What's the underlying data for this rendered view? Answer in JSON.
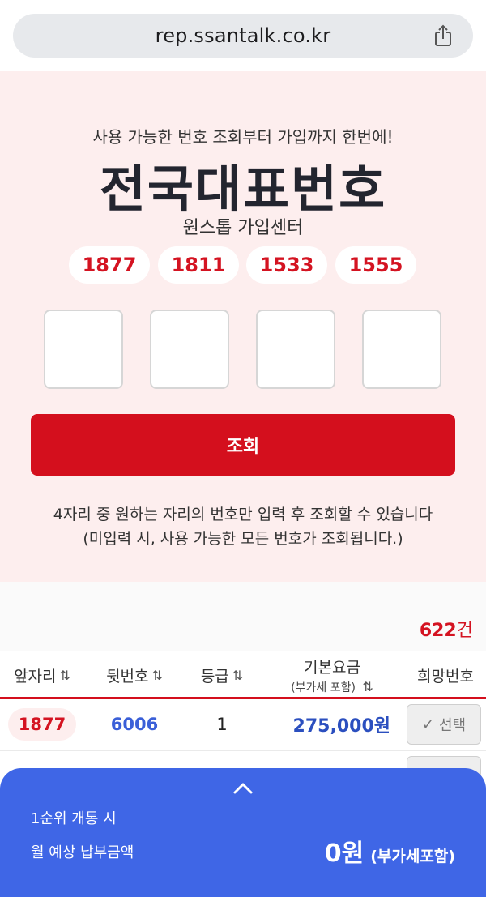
{
  "browser": {
    "url": "rep.ssantalk.co.kr",
    "share_icon": "share-icon"
  },
  "hero": {
    "subtitle": "사용 가능한 번호 조회부터 가입까지 한번에!",
    "title": "전국대표번호",
    "caption": "원스톱 가입센터",
    "prefixes": [
      "1877",
      "1811",
      "1533",
      "1555"
    ],
    "digit_boxes": [
      "",
      "",
      "",
      ""
    ],
    "search_label": "조회",
    "notice_line1": "4자리 중 원하는 자리의 번호만 입력 후 조회할 수 있습니다",
    "notice_line2": "(미입력 시, 사용 가능한 모든 번호가 조회됩니다.)"
  },
  "results": {
    "count_number": "622",
    "count_unit": "건",
    "columns": {
      "front": "앞자리",
      "back": "뒷번호",
      "grade": "등급",
      "base_fee": "기본요금",
      "base_fee_sub": "(부가세 포함)",
      "desired": "희망번호",
      "sort_icon": "⇅"
    },
    "rows": [
      {
        "front": "1877",
        "back": "6006",
        "grade": "1",
        "price": "275,000원",
        "action": "선택"
      }
    ]
  },
  "bottom_sheet": {
    "chevron_icon": "chevron-up-icon",
    "line1": "1순위 개통 시",
    "line2": "월 예상 납부금액",
    "amount": "0원",
    "vat_note": "(부가세포함)"
  },
  "colors": {
    "brand_red": "#d40f1d",
    "hero_bg": "#fdeeee",
    "sheet_blue": "#3f66e6",
    "link_blue": "#3a5fd8"
  }
}
